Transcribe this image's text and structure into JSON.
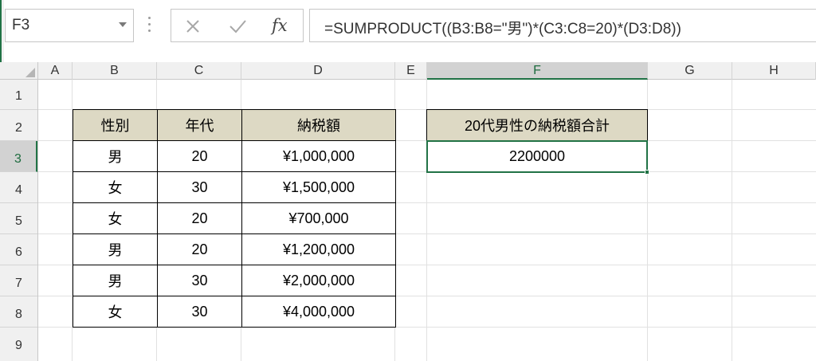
{
  "name_box": {
    "value": "F3"
  },
  "formula_bar": {
    "cancel_icon": "close-icon",
    "enter_icon": "check-icon",
    "fx_label": "fx",
    "formula": "=SUMPRODUCT((B3:B8=\"男\")*(C3:C8=20)*(D3:D8))"
  },
  "columns": [
    "A",
    "B",
    "C",
    "D",
    "E",
    "F",
    "G",
    "H"
  ],
  "active_column": "F",
  "rows": [
    "1",
    "2",
    "3",
    "4",
    "5",
    "6",
    "7",
    "8",
    "9"
  ],
  "active_row": "3",
  "table": {
    "headers": [
      "性別",
      "年代",
      "納税額"
    ],
    "rows": [
      [
        "男",
        "20",
        "¥1,000,000"
      ],
      [
        "女",
        "30",
        "¥1,500,000"
      ],
      [
        "女",
        "20",
        "¥700,000"
      ],
      [
        "男",
        "20",
        "¥1,200,000"
      ],
      [
        "男",
        "30",
        "¥2,000,000"
      ],
      [
        "女",
        "30",
        "¥4,000,000"
      ]
    ]
  },
  "result": {
    "header": "20代男性の納税額合計",
    "value": "2200000"
  },
  "colors": {
    "accent": "#217346",
    "header_fill": "#ddd9c4"
  }
}
